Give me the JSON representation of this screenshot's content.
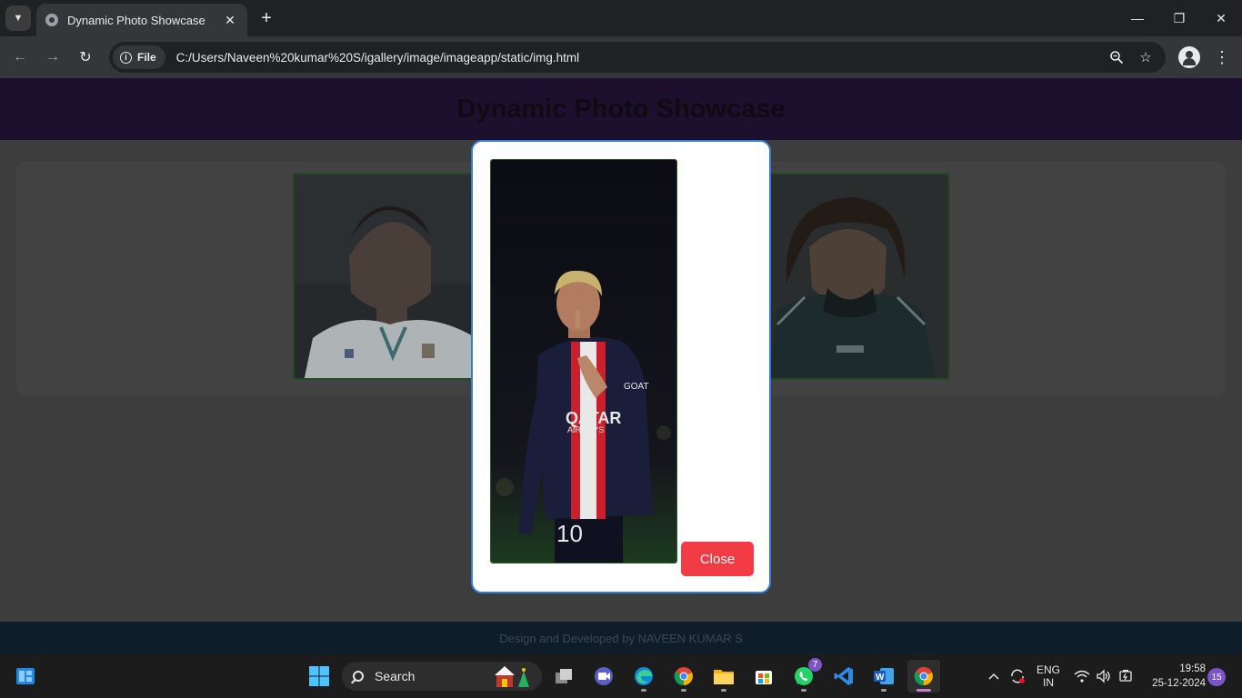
{
  "browser": {
    "tab_title": "Dynamic Photo Showcase",
    "url_chip": "File",
    "url": "C:/Users/Naveen%20kumar%20S/igallery/image/imageapp/static/img.html"
  },
  "page": {
    "title": "Dynamic Photo Showcase",
    "gallery_images": [
      {
        "name": "Player photo 1"
      },
      {
        "name": "Player photo 2"
      }
    ],
    "footer": "Design and Developed by NAVEEN KUMAR S"
  },
  "modal": {
    "close_label": "Close"
  },
  "taskbar": {
    "search_label": "Search",
    "whatsapp_badge": "7",
    "language_line1": "ENG",
    "language_line2": "IN",
    "time": "19:58",
    "date": "25-12-2024",
    "notification_count": "15"
  },
  "colors": {
    "header_bg": "#1d0f2e",
    "modal_border": "#2f7fd6",
    "close_button": "#f23c45",
    "thumb_border": "#234a22"
  }
}
